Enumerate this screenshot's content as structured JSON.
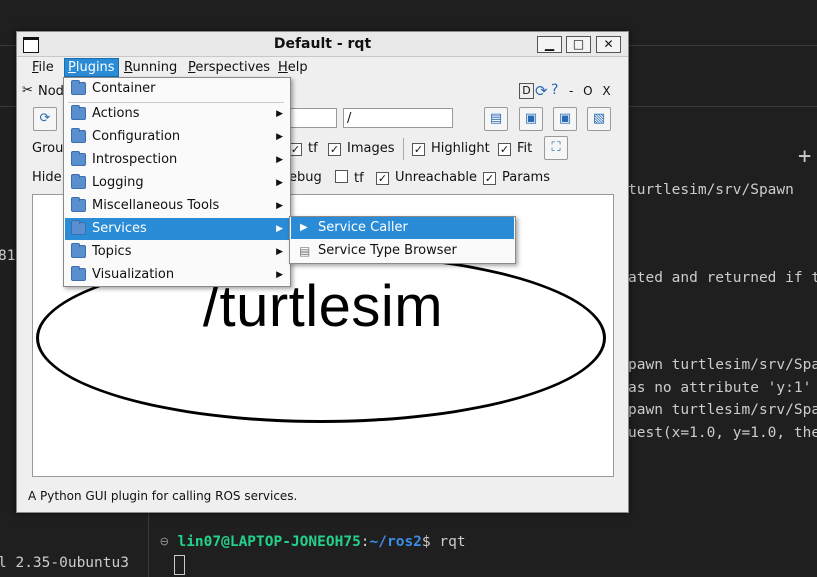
{
  "terminal": {
    "lines": [
      "turtlesim/srv/Spawn",
      "ated and returned if t",
      "pawn turtlesim/srv/Spa",
      "as no attribute 'y:1'",
      "pawn turtlesim/srv/Spa",
      "uest(x=1.0, y=1.0, the"
    ],
    "left_fragment": "81",
    "bottom_left": "l 2.35-0ubuntu3",
    "plus": "+",
    "prompt_user": "lin07@LAPTOP-JONEOH75",
    "prompt_sep": ":",
    "prompt_path": "~/ros2",
    "prompt_symbol": "$",
    "command": "rqt"
  },
  "window": {
    "title": "Default - rqt",
    "buttons": {
      "minimize": "▁",
      "maximize": "□",
      "close": "✕"
    }
  },
  "menubar": {
    "items": [
      {
        "label": "File",
        "underline": "F",
        "rest": "ile"
      },
      {
        "label": "Plugins",
        "underline": "P",
        "rest": "lugins"
      },
      {
        "label": "Running",
        "underline": "R",
        "rest": "unning"
      },
      {
        "label": "Perspectives",
        "underline": "P",
        "rest": "erspectives"
      },
      {
        "label": "Help",
        "underline": "H",
        "rest": "elp"
      }
    ]
  },
  "plugin_header": {
    "title_fragment": "Nod",
    "controls": [
      "D",
      "- O X"
    ]
  },
  "filters": {
    "input1_value": "",
    "input2_value": "/"
  },
  "group_row": {
    "label": "Group",
    "checks": [
      {
        "label": "tf",
        "checked": true
      },
      {
        "label": "Images",
        "checked": true
      },
      {
        "label": "Highlight",
        "checked": true
      },
      {
        "label": "Fit",
        "checked": true
      }
    ]
  },
  "hide_row": {
    "label": "Hide:",
    "fragment": "ebug",
    "checks": [
      {
        "label": "tf",
        "checked": false
      },
      {
        "label": "Unreachable",
        "checked": true
      },
      {
        "label": "Params",
        "checked": true
      }
    ]
  },
  "graph": {
    "node_label": "/turtlesim"
  },
  "status": {
    "text": "A Python GUI plugin for calling ROS services."
  },
  "plugins_menu": {
    "items": [
      {
        "label": "Container",
        "submenu": false
      },
      {
        "label": "Actions",
        "submenu": true
      },
      {
        "label": "Configuration",
        "submenu": true
      },
      {
        "label": "Introspection",
        "submenu": true
      },
      {
        "label": "Logging",
        "submenu": true
      },
      {
        "label": "Miscellaneous Tools",
        "submenu": true
      },
      {
        "label": "Services",
        "submenu": true,
        "highlighted": true
      },
      {
        "label": "Topics",
        "submenu": true
      },
      {
        "label": "Visualization",
        "submenu": true
      }
    ]
  },
  "services_submenu": {
    "items": [
      {
        "label": "Service Caller",
        "highlighted": true
      },
      {
        "label": "Service Type Browser",
        "highlighted": false
      }
    ]
  },
  "colors": {
    "highlight": "#2a8bd6",
    "terminal_bg": "#1f1f1f",
    "prompt_user": "#23d18b",
    "prompt_path": "#3b8eea"
  }
}
